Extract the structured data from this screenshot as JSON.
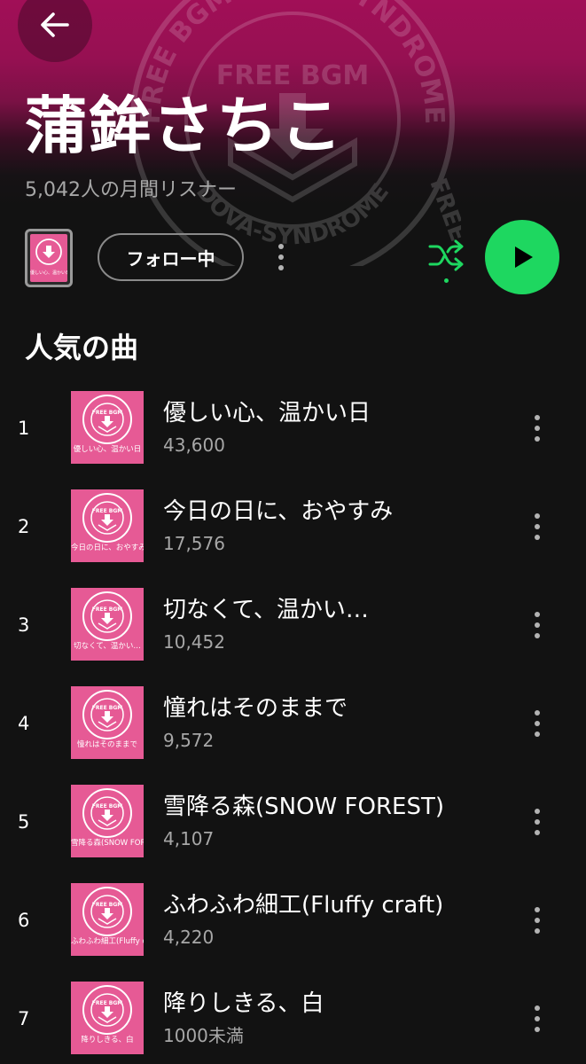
{
  "artist": {
    "name": "蒲鉾さちこ",
    "monthly_listeners": "5,042人の月間リスナー"
  },
  "hero_watermark_text": {
    "top": "FREE BGM DOVA-SYNDROME",
    "center": "FREE BGM",
    "bottom": "DOVA-SYNDROME",
    "side": "FREE"
  },
  "artwork_watermark": {
    "center": "FREE BGM",
    "ring": "FREE BGM DOVA-SYNDROME"
  },
  "actions": {
    "follow_label": "フォロー中",
    "cover_caption": "優しい心、温かい日"
  },
  "section_title": "人気の曲",
  "colors": {
    "accent_green": "#1ed760",
    "artwork_pink": "#e65a95",
    "hero_magenta": "#a10f57",
    "background": "#121212"
  },
  "icons": {
    "back": "back-arrow-icon",
    "more": "more-vertical-icon",
    "shuffle": "shuffle-icon",
    "play": "play-icon"
  },
  "tracks": [
    {
      "rank": "1",
      "title": "優しい心、温かい日",
      "plays": "43,600",
      "art_caption": "優しい心、温かい日"
    },
    {
      "rank": "2",
      "title": "今日の日に、おやすみ",
      "plays": "17,576",
      "art_caption": "今日の日に、おやすみ"
    },
    {
      "rank": "3",
      "title": "切なくて、温かい…",
      "plays": "10,452",
      "art_caption": "切なくて、温かい…"
    },
    {
      "rank": "4",
      "title": "憧れはそのままで",
      "plays": "9,572",
      "art_caption": "憧れはそのままで"
    },
    {
      "rank": "5",
      "title": "雪降る森(SNOW FOREST)",
      "plays": "4,107",
      "art_caption": "雪降る森(SNOW FOREST)"
    },
    {
      "rank": "6",
      "title": "ふわふわ細工(Fluffy craft)",
      "plays": "4,220",
      "art_caption": "ふわふわ細工(Fluffy craft)"
    },
    {
      "rank": "7",
      "title": "降りしきる、白",
      "plays": "1000未満",
      "art_caption": "降りしきる、白"
    }
  ]
}
